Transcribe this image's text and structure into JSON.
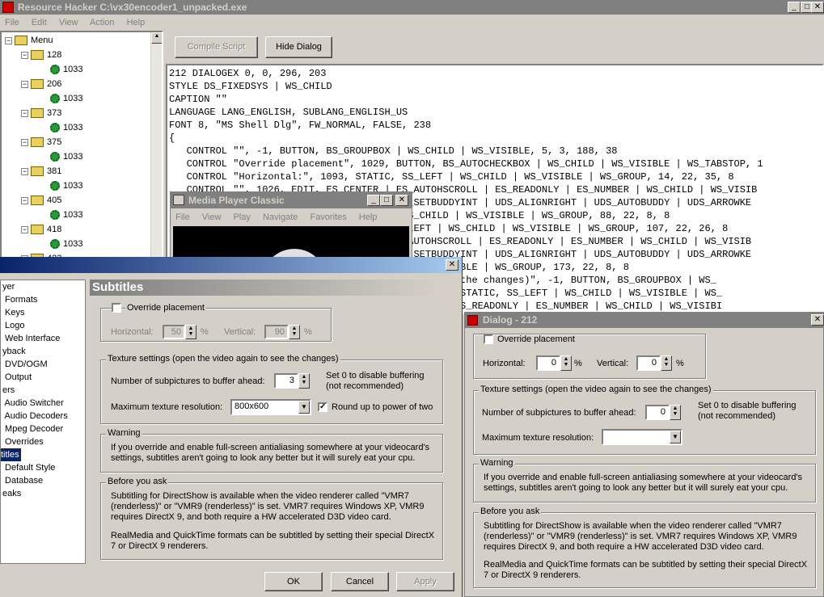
{
  "rh": {
    "title": "Resource Hacker   C:\\vx30encoder1_unpacked.exe",
    "menu": [
      "File",
      "Edit",
      "View",
      "Action",
      "Help"
    ],
    "compile_label": "Compile Script",
    "hide_label": "Hide Dialog",
    "tree_root": "Menu",
    "tree": [
      {
        "id": "128",
        "child": "1033"
      },
      {
        "id": "206",
        "child": "1033"
      },
      {
        "id": "373",
        "child": "1033"
      },
      {
        "id": "375",
        "child": "1033"
      },
      {
        "id": "381",
        "child": "1033"
      },
      {
        "id": "405",
        "child": "1033"
      },
      {
        "id": "418",
        "child": "1033"
      },
      {
        "id": "423",
        "child": ""
      }
    ],
    "code_lines": [
      "212 DIALOGEX 0, 0, 296, 203",
      "STYLE DS_FIXEDSYS | WS_CHILD",
      "CAPTION \"\"",
      "LANGUAGE LANG_ENGLISH, SUBLANG_ENGLISH_US",
      "FONT 8, \"MS Shell Dlg\", FW_NORMAL, FALSE, 238",
      "{",
      "   CONTROL \"\", -1, BUTTON, BS_GROUPBOX | WS_CHILD | WS_VISIBLE, 5, 3, 188, 38",
      "   CONTROL \"Override placement\", 1029, BUTTON, BS_AUTOCHECKBOX | WS_CHILD | WS_VISIBLE | WS_TABSTOP, 1",
      "   CONTROL \"Horizontal:\", 1093, STATIC, SS_LEFT | WS_CHILD | WS_VISIBLE | WS_GROUP, 14, 22, 35, 8",
      "   CONTROL \"\", 1026, EDIT, ES_CENTER | ES_AUTOHSCROLL | ES_READONLY | ES_NUMBER | WS_CHILD | WS_VISIB",
      "                                      UDS_SETBUDDYINT | UDS_ALIGNRIGHT | UDS_AUTOBUDDY | UDS_ARROWKE",
      "                                      | WS_CHILD | WS_VISIBLE | WS_GROUP, 88, 22, 8, 8",
      "                                      SS_LEFT | WS_CHILD | WS_VISIBLE | WS_GROUP, 107, 22, 26, 8",
      "                                      ES_AUTOHSCROLL | ES_READONLY | ES_NUMBER | WS_CHILD | WS_VISIB",
      "                                      UDS_SETBUDDYINT | UDS_ALIGNRIGHT | UDS_AUTOBUDDY | UDS_ARROWKE",
      "                                      LD | WS_VISIBLE | WS_GROUP, 173, 22, 8, 8",
      "                                      gain to see the changes)\", -1, BUTTON, BS_GROUPBOX | WS_",
      "                                      head:\", -1, STATIC, SS_LEFT | WS_CHILD | WS_VISIBLE | WS_",
      "                                      OHSCROLL | ES_READONLY | ES_NUMBER | WS_CHILD | WS_VISIBI"
    ]
  },
  "mpc": {
    "title": "Media Player Classic",
    "menu": [
      "File",
      "View",
      "Play",
      "Navigate",
      "Favorites",
      "Help"
    ]
  },
  "opts": {
    "nav": [
      {
        "label": "yer"
      },
      {
        "label": " Formats"
      },
      {
        "label": " Keys"
      },
      {
        "label": " Logo"
      },
      {
        "label": " Web Interface"
      },
      {
        "label": "yback"
      },
      {
        "label": " DVD/OGM"
      },
      {
        "label": " Output"
      },
      {
        "label": "ers"
      },
      {
        "label": " Audio Switcher"
      },
      {
        "label": " Audio Decoders"
      },
      {
        "label": " Mpeg Decoder"
      },
      {
        "label": " Overrides"
      },
      {
        "label": "titles"
      },
      {
        "label": " Default Style"
      },
      {
        "label": " Database"
      },
      {
        "label": "eaks"
      }
    ],
    "header": "Subtitles",
    "override_label": "Override placement",
    "horizontal_label": "Horizontal:",
    "horizontal_value": "50",
    "vertical_label": "Vertical:",
    "vertical_value": "90",
    "percent": "%",
    "texture_group": "Texture settings (open the video again to see the changes)",
    "subpic_label": "Number of subpictures to buffer ahead:",
    "subpic_value": "3",
    "buffer_note": "Set 0 to disable buffering (not recommended)",
    "maxtex_label": "Maximum texture resolution:",
    "maxtex_value": "800x600",
    "round_label": "Round up to power of two",
    "warning_group": "Warning",
    "warning_text": "If you override and enable full-screen antialiasing somewhere at your videocard's settings, subtitles aren't going to look any better but it will surely eat your cpu.",
    "before_group": "Before you ask",
    "before_text1": "Subtitling for DirectShow is available when the video renderer called \"VMR7 (renderless)\" or \"VMR9 (renderless)\" is set. VMR7 requires Windows XP, VMR9 requires DirectX 9, and both require a HW accelerated D3D video card.",
    "before_text2": "RealMedia and QuickTime formats can be subtitled by setting their special DirectX 7 or DirectX 9 renderers.",
    "ok": "OK",
    "cancel": "Cancel",
    "apply": "Apply"
  },
  "dlg": {
    "title": "Dialog - 212",
    "override_label": "Override placement",
    "horizontal_label": "Horizontal:",
    "horizontal_value": "0",
    "vertical_label": "Vertical:",
    "vertical_value": "0",
    "percent": "%",
    "texture_group": "Texture settings (open the video again to see the changes)",
    "subpic_label": "Number of subpictures to buffer ahead:",
    "subpic_value": "0",
    "buffer_note": "Set 0 to disable buffering (not recommended)",
    "maxtex_label": "Maximum texture resolution:",
    "warning_group": "Warning",
    "warning_text": "If you override and enable full-screen antialiasing somewhere at your videocard's settings, subtitles aren't going to look any better but it will surely eat your cpu.",
    "before_group": "Before you ask",
    "before_text1": "Subtitling for DirectShow is available when the video renderer called \"VMR7 (renderless)\" or \"VMR9 (renderless)\" is set. VMR7 requires Windows XP, VMR9 requires DirectX 9, and both require a HW accelerated D3D video card.",
    "before_text2": "RealMedia and QuickTime formats can be subtitled by setting their special DirectX 7 or DirectX 9 renderers."
  }
}
